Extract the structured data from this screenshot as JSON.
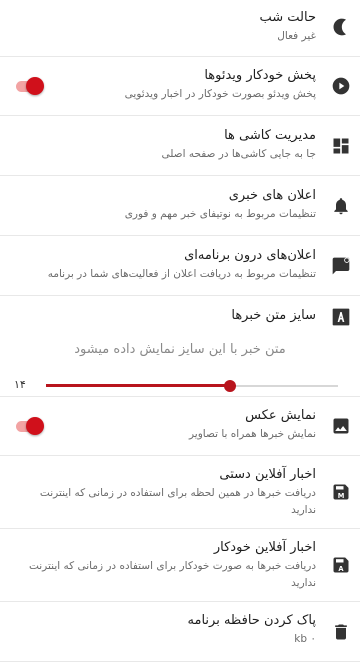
{
  "accent_color": "#d0101b",
  "settings": {
    "night_mode": {
      "title": "حالت شب",
      "subtitle": "غیر فعال",
      "icon": "moon-icon"
    },
    "autoplay": {
      "title": "پخش خودکار ویدئوها",
      "subtitle": "پخش ویدئو بصورت خودکار در اخبار ویدئویی",
      "icon": "play-circle-icon",
      "enabled": true
    },
    "tiles": {
      "title": "مدیریت کاشی ها",
      "subtitle": "جا به جایی کاشی‌ها در صفحه اصلی",
      "icon": "dashboard-icon"
    },
    "news_notifications": {
      "title": "اعلان های خبری",
      "subtitle": "تنظیمات مربوط به نوتیفای خبر مهم و فوری",
      "icon": "bell-icon"
    },
    "in_app_notifications": {
      "title": "اعلان‌های درون برنامه‌ای",
      "subtitle": "تنظیمات مربوط به دریافت اعلان از فعالیت‌های شما در برنامه",
      "icon": "message-flag-icon"
    },
    "font_size": {
      "title": "سایز متن خبرها",
      "preview": "متن خبر با این سایز نمایش داده میشود",
      "value_label": "۱۴",
      "value_fraction": 0.63,
      "icon": "font-size-icon"
    },
    "show_images": {
      "title": "نمایش عکس",
      "subtitle": "نمایش خبرها همراه با تصاویر",
      "icon": "image-icon",
      "enabled": true
    },
    "manual_offline": {
      "title": "اخبار آفلاین دستی",
      "subtitle": "دریافت خبرها در همین لحظه برای استفاده در زمانی که اینترنت ندارید",
      "icon": "save-m-icon"
    },
    "auto_offline": {
      "title": "اخبار آفلاین خودکار",
      "subtitle": "دریافت خبرها به صورت خودکار برای استفاده در زمانی که اینترنت ندارید",
      "icon": "save-a-icon"
    },
    "clear_cache": {
      "title": "پاک کردن حافظه برنامه",
      "subtitle": "۰ kb",
      "icon": "trash-icon"
    }
  }
}
